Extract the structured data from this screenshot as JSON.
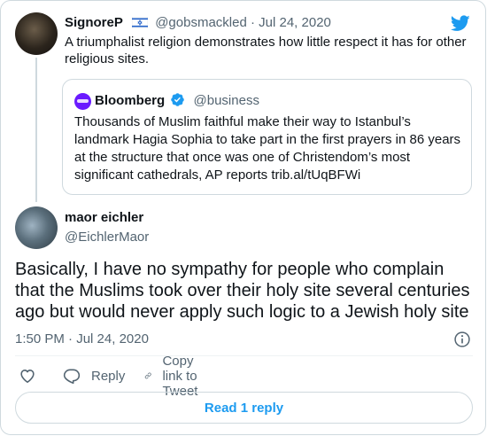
{
  "parent_tweet": {
    "name": "SignoreP",
    "handle": "@gobsmackled",
    "separator": "·",
    "date": "Jul 24, 2020",
    "text": "A triumphalist religion demonstrates how little respect it has for other religious sites.",
    "quoted": {
      "name": "Bloomberg",
      "handle": "@business",
      "logo_text": "Bloomberg",
      "text": "Thousands of Muslim faithful make their way to Istanbul’s landmark Hagia Sophia to take part in the first prayers in 86 years at the structure that once was one of Christendom’s most significant cathedrals, AP reports trib.al/tUqBFWi"
    }
  },
  "main_tweet": {
    "name": "maor eichler",
    "handle": "@EichlerMaor",
    "lines": [
      "Basically, I have no sympathy for people who complain",
      "that the Muslims took over their holy site several centuries",
      "ago but would never apply such logic to a Jewish holy site"
    ],
    "time": "1:50 PM",
    "separator": "·",
    "date": "Jul 24, 2020"
  },
  "actions": {
    "reply_label": "Reply",
    "copy_label": "Copy link to Tweet"
  },
  "read_replies_label": "Read 1 reply",
  "colors": {
    "accent": "#1d9bf0",
    "muted_text": "#536471",
    "border": "#cfd9de",
    "bloomberg_purple": "#6a1aff"
  },
  "icons": [
    "twitter-bird-icon",
    "israel-flag-icon",
    "verified-badge-icon",
    "info-icon",
    "heart-icon",
    "reply-icon",
    "link-icon"
  ]
}
